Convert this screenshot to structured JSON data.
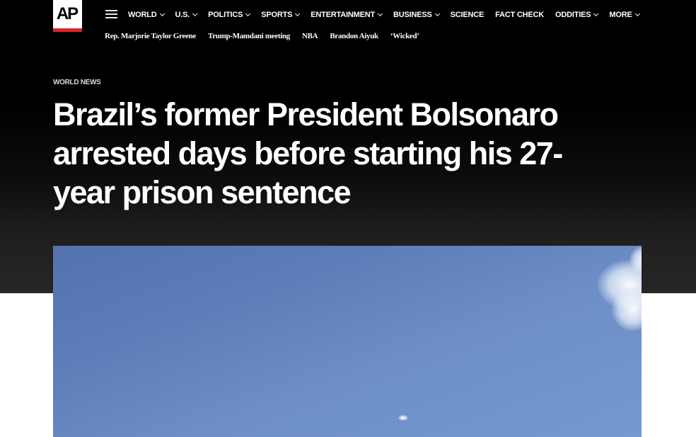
{
  "brand": {
    "logo_text": "AP",
    "accent_color": "#e0252b"
  },
  "nav": {
    "menu_icon": "hamburger-menu-icon",
    "items": [
      {
        "label": "WORLD",
        "dropdown": true
      },
      {
        "label": "U.S.",
        "dropdown": true
      },
      {
        "label": "POLITICS",
        "dropdown": true
      },
      {
        "label": "SPORTS",
        "dropdown": true
      },
      {
        "label": "ENTERTAINMENT",
        "dropdown": true
      },
      {
        "label": "BUSINESS",
        "dropdown": true
      },
      {
        "label": "SCIENCE",
        "dropdown": false
      },
      {
        "label": "FACT CHECK",
        "dropdown": false
      },
      {
        "label": "ODDITIES",
        "dropdown": true
      },
      {
        "label": "MORE",
        "dropdown": true
      }
    ]
  },
  "trending": [
    "Rep. Marjorie Taylor Greene",
    "Trump-Mamdani meeting",
    "NBA",
    "Brandon Aiyuk",
    "‘Wicked’"
  ],
  "article": {
    "section": "WORLD NEWS",
    "headline": "Brazil’s former President Bolsonaro arrested days before starting his 27-year prison sentence"
  },
  "colors": {
    "header_bg": "#000000",
    "text": "#ffffff",
    "sky": "#5d7db8"
  }
}
